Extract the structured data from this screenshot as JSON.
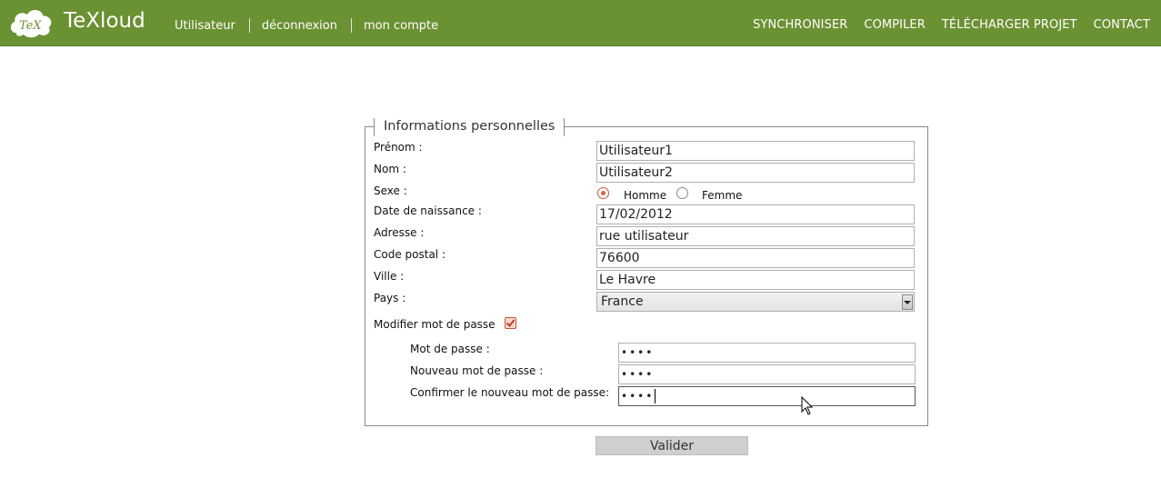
{
  "header": {
    "logo_text": "TeX",
    "brand": "TeXloud",
    "left_nav": [
      "Utilisateur",
      "déconnexion",
      "mon compte"
    ],
    "right_nav": [
      "SYNCHRONISER",
      "COMPILER",
      "TÉLÉCHARGER PROJET",
      "CONTACT"
    ]
  },
  "form": {
    "legend": "Informations personnelles",
    "prenom": {
      "label": "Prénom :",
      "value": "Utilisateur1"
    },
    "nom": {
      "label": "Nom :",
      "value": "Utilisateur2"
    },
    "sexe": {
      "label": "Sexe :",
      "options": [
        "Homme",
        "Femme"
      ],
      "selected": "Homme"
    },
    "naissance": {
      "label": "Date de naissance :",
      "value": "17/02/2012"
    },
    "adresse": {
      "label": "Adresse :",
      "value": "rue utilisateur"
    },
    "code_postal": {
      "label": "Code postal :",
      "value": "76600"
    },
    "ville": {
      "label": "Ville :",
      "value": "Le Havre"
    },
    "pays": {
      "label": "Pays :",
      "value": "France"
    },
    "modifier_mdp": {
      "label": "Modifier mot de passe",
      "checked": true
    },
    "mdp": {
      "label": "Mot de passe :",
      "value": "••••"
    },
    "nouveau_mdp": {
      "label": "Nouveau mot de passe :",
      "value": "••••"
    },
    "confirmer_mdp": {
      "label": "Confirmer le nouveau mot de passe:",
      "value": "••••"
    },
    "submit": "Valider"
  },
  "colors": {
    "header_bg": "#6a9132",
    "accent": "#e0603a"
  }
}
